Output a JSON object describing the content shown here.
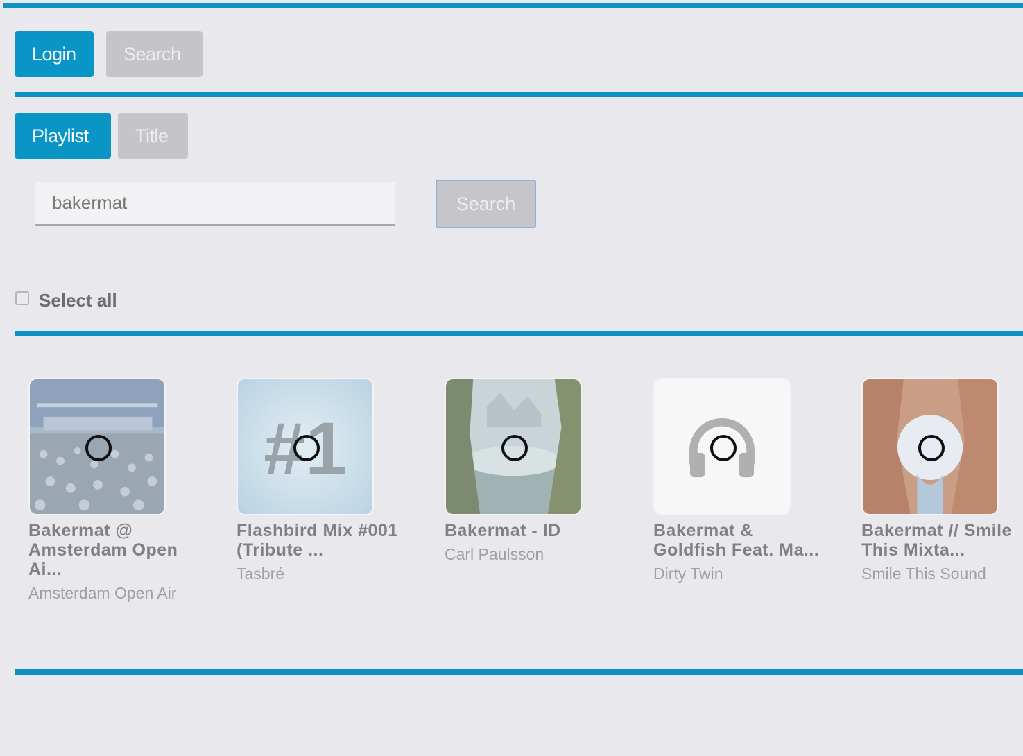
{
  "top_tabs": [
    {
      "label": "Login",
      "active": true
    },
    {
      "label": "Search",
      "active": false
    }
  ],
  "mode_tabs": [
    {
      "label": "Playlist",
      "active": true
    },
    {
      "label": "Title",
      "active": false
    }
  ],
  "search": {
    "value": "bakermat",
    "button_label": "Search"
  },
  "select_all": {
    "label": "Select all",
    "checked": false
  },
  "results": [
    {
      "title": "Bakermat @ Amsterdam Open Ai...",
      "artist": "Amsterdam Open Air",
      "thumb": "crowd"
    },
    {
      "title": "Flashbird Mix #001 (Tribute ...",
      "artist": "Tasbré",
      "thumb": "number-one",
      "thumb_text": "#1"
    },
    {
      "title": "Bakermat - ID",
      "artist": "Carl Paulsson",
      "thumb": "cliffs"
    },
    {
      "title": "Bakermat & Goldfish Feat. Ma...",
      "artist": "Dirty Twin",
      "thumb": "headphones-placeholder"
    },
    {
      "title": "Bakermat // Smile This Mixta...",
      "artist": "Smile This Sound",
      "thumb": "canyon"
    }
  ],
  "colors": {
    "accent": "#0b93c6",
    "background": "#e9e8ec",
    "inactive_button": "#c5c4c8"
  }
}
